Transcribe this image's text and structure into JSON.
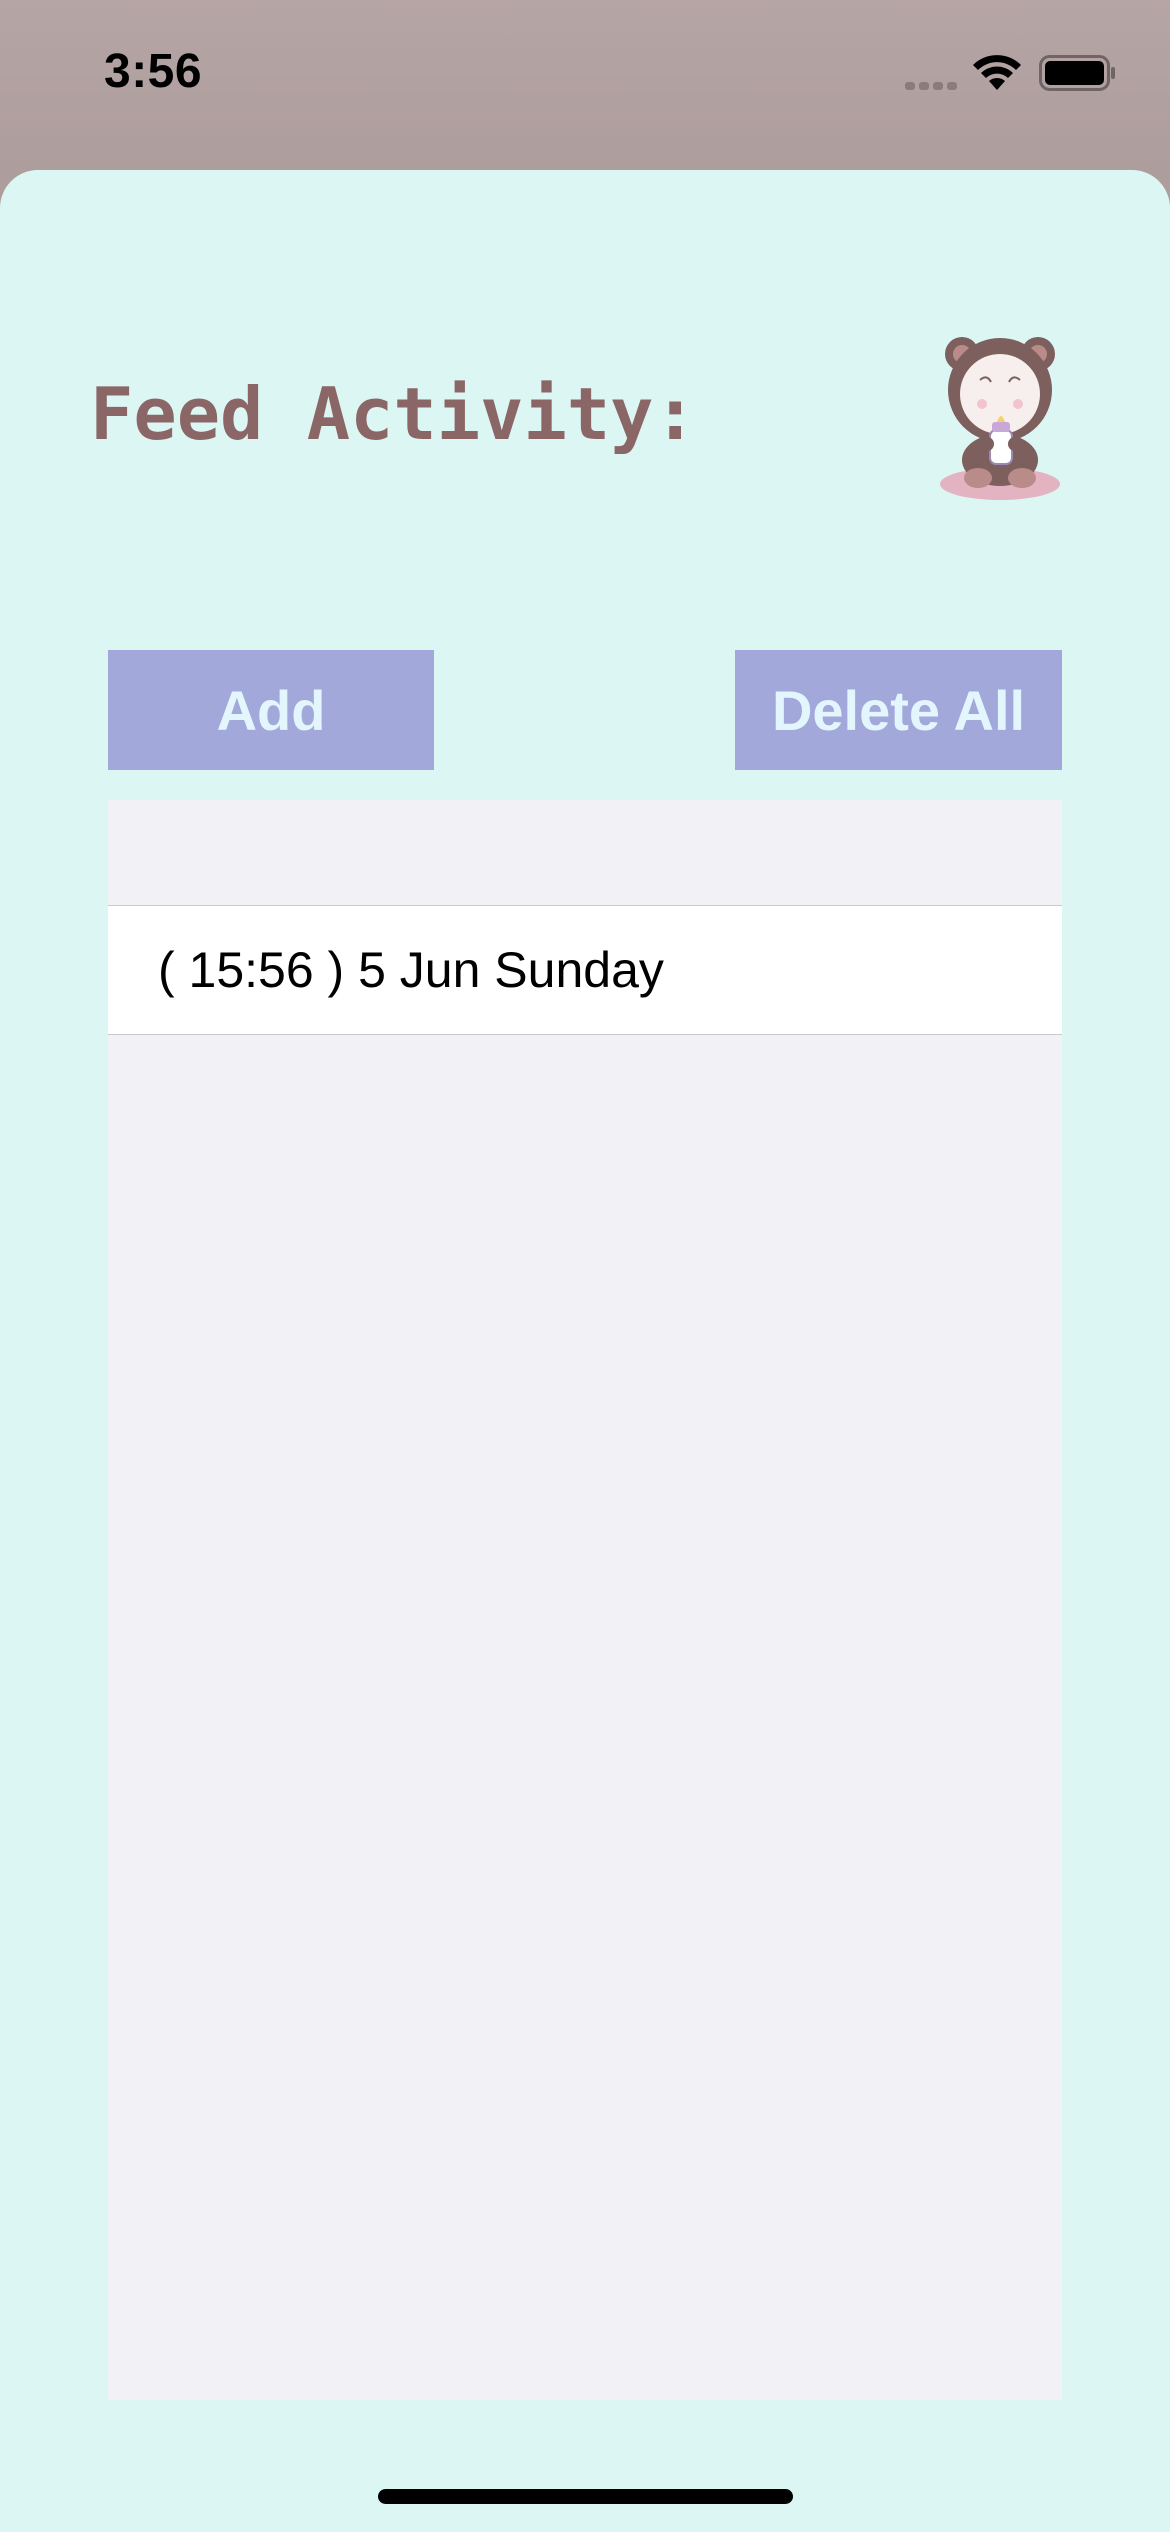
{
  "status_bar": {
    "time": "3:56",
    "icons": [
      "signal-icon",
      "wifi-icon",
      "battery-icon"
    ]
  },
  "screen": {
    "title": "Feed Activity:",
    "mascot": "baby-bear-bottle-icon"
  },
  "buttons": {
    "add_label": "Add",
    "delete_all_label": "Delete All"
  },
  "feed_list": {
    "rows": [
      {
        "label": "( 15:56 ) 5 Jun Sunday"
      }
    ]
  },
  "colors": {
    "sheet_background": "#dcf6f3",
    "header_background": "#b6a5a5",
    "title_color": "#8b6666",
    "button_background": "#a2a8da",
    "button_text": "#e4f6fd",
    "table_background": "#f1f1f6"
  }
}
